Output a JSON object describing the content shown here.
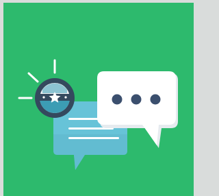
{
  "illustration": {
    "icons": {
      "background": "square-tile",
      "front_bubble": "speech-bubble-ellipsis-icon",
      "back_bubble": "chat-bubble-lines-icon",
      "badge": "star-badge-icon",
      "rays": "notification-rays-icon"
    },
    "colors": {
      "outer_border": "#d9dcdb",
      "tile_green": "#2dba6d",
      "bubble_white": "#ffffff",
      "bubble_shadow": "#e6ebef",
      "bubble_blue": "#67c3d8",
      "bubble_blue_dark": "#56adc4",
      "dot_navy": "#3b4f6e",
      "badge_ring": "#34495e",
      "badge_inner": "#eef1f3",
      "badge_band": "#3c9db4",
      "rays_white": "#ffffff"
    },
    "typing_dots_count": 3
  }
}
